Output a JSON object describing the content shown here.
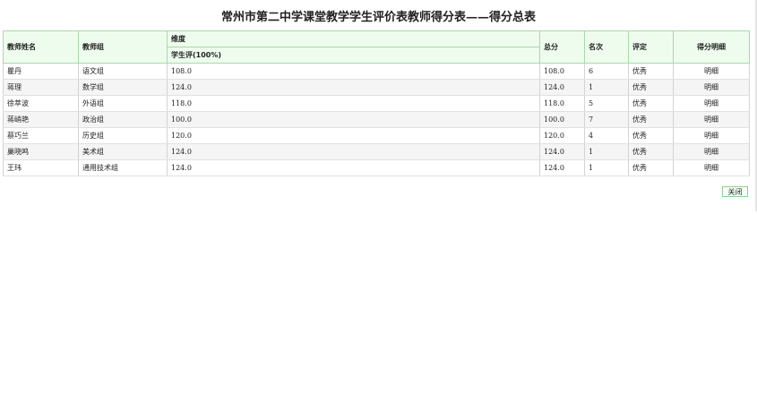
{
  "page": {
    "title": "常州市第二中学课堂教学学生评价表教师得分表——得分总表"
  },
  "table": {
    "headers": {
      "teacher_name": "教师姓名",
      "teacher_group": "教师组",
      "dimension": "维度",
      "dimension_sub": "学生评(100%)",
      "total": "总分",
      "rank": "名次",
      "rating": "评定",
      "detail": "得分明细"
    },
    "rows": [
      {
        "name": "瞿丹",
        "group": "语文组",
        "score": "108.0",
        "total": "108.0",
        "rank": "6",
        "rating": "优秀",
        "detail": "明细"
      },
      {
        "name": "蒋理",
        "group": "数学组",
        "score": "124.0",
        "total": "124.0",
        "rank": "1",
        "rating": "优秀",
        "detail": "明细"
      },
      {
        "name": "徐萃波",
        "group": "外语组",
        "score": "118.0",
        "total": "118.0",
        "rank": "5",
        "rating": "优秀",
        "detail": "明细"
      },
      {
        "name": "蒋峭艳",
        "group": "政治组",
        "score": "100.0",
        "total": "100.0",
        "rank": "7",
        "rating": "优秀",
        "detail": "明细"
      },
      {
        "name": "蔡巧兰",
        "group": "历史组",
        "score": "120.0",
        "total": "120.0",
        "rank": "4",
        "rating": "优秀",
        "detail": "明细"
      },
      {
        "name": "巢晓鸣",
        "group": "美术组",
        "score": "124.0",
        "total": "124.0",
        "rank": "1",
        "rating": "优秀",
        "detail": "明细"
      },
      {
        "name": "王玮",
        "group": "通用技术组",
        "score": "124.0",
        "total": "124.0",
        "rank": "1",
        "rating": "优秀",
        "detail": "明细"
      }
    ]
  },
  "actions": {
    "close_label": "关闭"
  }
}
